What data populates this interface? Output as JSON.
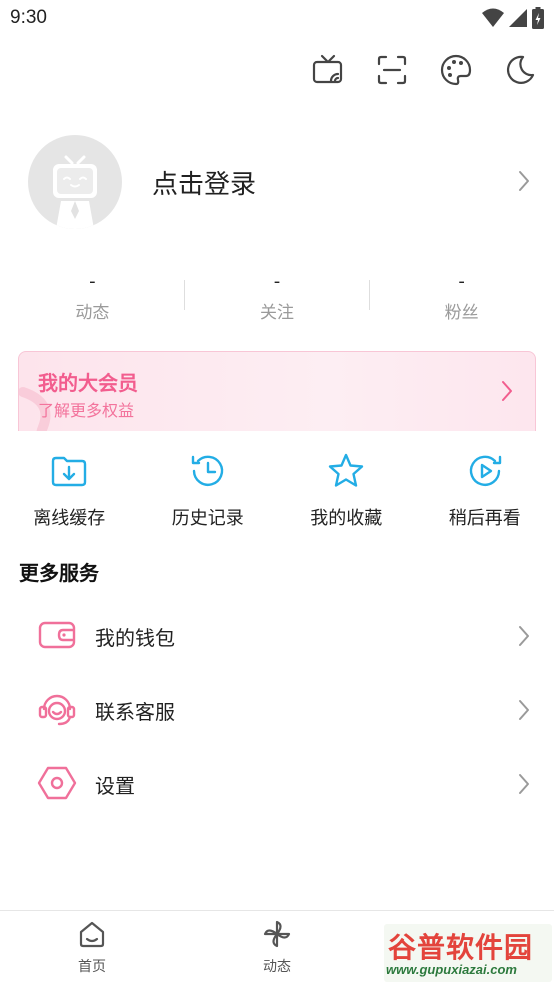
{
  "status_bar": {
    "time": "9:30"
  },
  "top_icons": [
    "tv-cast-icon",
    "scan-icon",
    "palette-icon",
    "moon-icon"
  ],
  "profile": {
    "login_text": "点击登录"
  },
  "stats": [
    {
      "value": "-",
      "label": "动态"
    },
    {
      "value": "-",
      "label": "关注"
    },
    {
      "value": "-",
      "label": "粉丝"
    }
  ],
  "vip": {
    "title": "我的大会员",
    "subtitle": "了解更多权益"
  },
  "quick_actions": [
    {
      "label": "离线缓存",
      "icon": "download-folder-icon"
    },
    {
      "label": "历史记录",
      "icon": "history-icon"
    },
    {
      "label": "我的收藏",
      "icon": "star-icon"
    },
    {
      "label": "稍后再看",
      "icon": "watch-later-icon"
    }
  ],
  "more_services": {
    "title": "更多服务",
    "items": [
      {
        "label": "我的钱包",
        "icon": "wallet-icon"
      },
      {
        "label": "联系客服",
        "icon": "headset-icon"
      },
      {
        "label": "设置",
        "icon": "settings-icon"
      }
    ]
  },
  "bottom_nav": [
    {
      "label": "首页",
      "icon": "home-icon"
    },
    {
      "label": "动态",
      "icon": "pinwheel-icon"
    }
  ],
  "watermark": {
    "brand": "谷普软件园",
    "url": "www.gupuxiazai.com"
  },
  "colors": {
    "accent_pink": "#f25d8e",
    "accent_blue": "#23ade5",
    "text_gray": "#9a9a9a"
  }
}
